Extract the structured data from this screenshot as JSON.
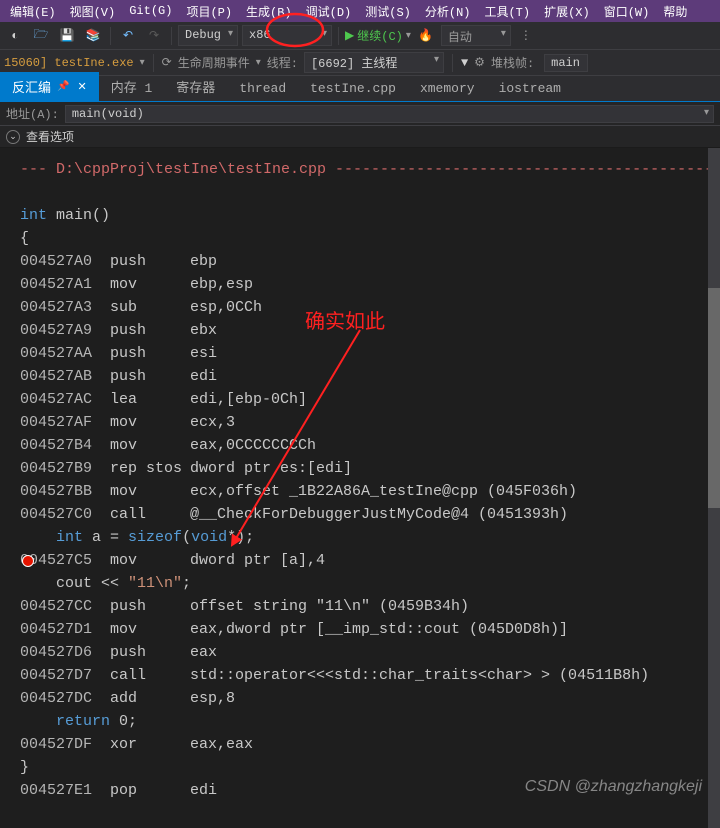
{
  "menubar": {
    "items": [
      "编辑(E)",
      "视图(V)",
      "Git(G)",
      "项目(P)",
      "生成(B)",
      "调试(D)",
      "测试(S)",
      "分析(N)",
      "工具(T)",
      "扩展(X)",
      "窗口(W)",
      "帮助"
    ]
  },
  "toolbar": {
    "config": "Debug",
    "platform": "x86",
    "continue": "继续(C)",
    "auto": "自动"
  },
  "toolbar2": {
    "process": "15060] testIne.exe",
    "lifecycle": "生命周期事件",
    "thread_lbl": "线程:",
    "thread": "[6692] 主线程",
    "stack_lbl": "堆栈帧:",
    "stack": "main"
  },
  "tabs": [
    {
      "label": "反汇编",
      "active": true
    },
    {
      "label": "内存 1"
    },
    {
      "label": "寄存器"
    },
    {
      "label": "thread"
    },
    {
      "label": "testIne.cpp"
    },
    {
      "label": "xmemory"
    },
    {
      "label": "iostream"
    }
  ],
  "addr_row": {
    "label": "地址(A):",
    "value": "main(void)"
  },
  "opts_row": {
    "label": "查看选项"
  },
  "annotation": {
    "text": "确实如此"
  },
  "watermark": "CSDN @zhangzhangkeji",
  "code": {
    "source_header": "--- D:\\cppProj\\testIne\\testIne.cpp -------------------------------------------",
    "lines": [
      {
        "t": "blank"
      },
      {
        "t": "src",
        "text": "int main()",
        "kw": "int"
      },
      {
        "t": "src",
        "text": "{"
      },
      {
        "t": "asm",
        "addr": "004527A0",
        "mn": "push",
        "op": "ebp"
      },
      {
        "t": "asm",
        "addr": "004527A1",
        "mn": "mov",
        "op": "ebp,esp"
      },
      {
        "t": "asm",
        "addr": "004527A3",
        "mn": "sub",
        "op": "esp,0CCh"
      },
      {
        "t": "asm",
        "addr": "004527A9",
        "mn": "push",
        "op": "ebx"
      },
      {
        "t": "asm",
        "addr": "004527AA",
        "mn": "push",
        "op": "esi"
      },
      {
        "t": "asm",
        "addr": "004527AB",
        "mn": "push",
        "op": "edi"
      },
      {
        "t": "asm",
        "addr": "004527AC",
        "mn": "lea",
        "op": "edi,[ebp-0Ch]"
      },
      {
        "t": "asm",
        "addr": "004527AF",
        "mn": "mov",
        "op": "ecx,3"
      },
      {
        "t": "asm",
        "addr": "004527B4",
        "mn": "mov",
        "op": "eax,0CCCCCCCCh"
      },
      {
        "t": "asm",
        "addr": "004527B9",
        "mn": "rep stos",
        "op": "dword ptr es:[edi]"
      },
      {
        "t": "asm",
        "addr": "004527BB",
        "mn": "mov",
        "op": "ecx,offset _1B22A86A_testIne@cpp (045F036h)"
      },
      {
        "t": "asm",
        "addr": "004527C0",
        "mn": "call",
        "op": "@__CheckForDebuggerJustMyCode@4 (0451393h)"
      },
      {
        "t": "srccustom",
        "html": "    <span class=\"kw\">int</span> a = <span class=\"kw\">sizeof</span>(<span class=\"kw\">void</span>*);"
      },
      {
        "t": "asm",
        "addr": "004527C5",
        "mn": "mov",
        "op": "dword ptr [a],4",
        "bp": true
      },
      {
        "t": "srccustom",
        "html": "    cout &lt;&lt; <span class=\"str\">\"11\\n\"</span>;"
      },
      {
        "t": "asm",
        "addr": "004527CC",
        "mn": "push",
        "op": "offset string \"11\\n\" (0459B34h)"
      },
      {
        "t": "asm",
        "addr": "004527D1",
        "mn": "mov",
        "op": "eax,dword ptr [__imp_std::cout (045D0D8h)]"
      },
      {
        "t": "asm",
        "addr": "004527D6",
        "mn": "push",
        "op": "eax"
      },
      {
        "t": "asm",
        "addr": "004527D7",
        "mn": "call",
        "op": "std::operator<<<std::char_traits<char> > (04511B8h)"
      },
      {
        "t": "asm",
        "addr": "004527DC",
        "mn": "add",
        "op": "esp,8"
      },
      {
        "t": "srccustom",
        "html": "    <span class=\"kw\">return</span> 0;"
      },
      {
        "t": "asm",
        "addr": "004527DF",
        "mn": "xor",
        "op": "eax,eax"
      },
      {
        "t": "src",
        "text": "}"
      },
      {
        "t": "asm",
        "addr": "004527E1",
        "mn": "pop",
        "op": "edi"
      }
    ]
  }
}
